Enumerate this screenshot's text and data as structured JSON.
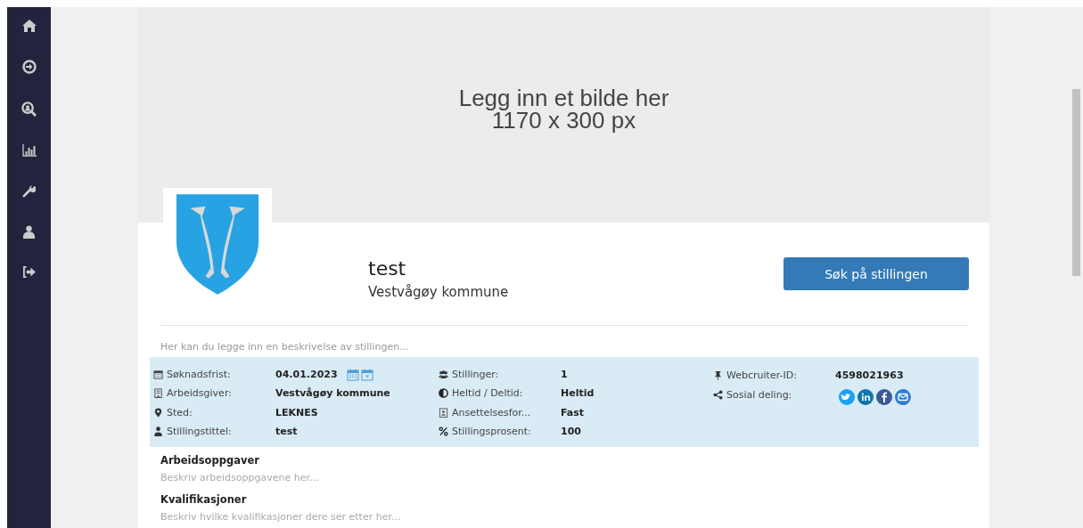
{
  "banner": {
    "lines": [
      "Legg inn et bilde her",
      "1170 x 300 px"
    ]
  },
  "job": {
    "title": "test",
    "employer": "Vestvågøy kommune"
  },
  "apply_button": "Søk på stillingen",
  "description": "Her kan du legge inn en beskrivelse av stillingen...",
  "facts": [
    [
      {
        "label": "Søknadsfrist:",
        "value": "04.01.2023"
      },
      {
        "label": "Arbeidsgiver:",
        "value": "Vestvågøy kommune"
      },
      {
        "label": "Sted:",
        "value": "LEKNES"
      },
      {
        "label": "Stillingstittel:",
        "value": "test"
      }
    ],
    [
      {
        "label": "Stillinger:",
        "value": "1"
      },
      {
        "label": "Heltid / Deltid:",
        "value": "Heltid"
      },
      {
        "label": "Ansettelsesfor...",
        "value": "Fast"
      },
      {
        "label": "Stillingsprosent:",
        "value": "100"
      }
    ],
    [
      {
        "label": "Webcruiter-ID:",
        "value": "4598021963"
      },
      {
        "label": "Sosial deling:",
        "kind": "social"
      }
    ]
  ],
  "sections": [
    {
      "heading": "Arbeidsoppgaver",
      "text": "Beskriv arbeidsoppgavene her..."
    },
    {
      "heading": "Kvalifikasjoner",
      "text": "Beskriv hvilke kvalifikasjoner dere ser etter her..."
    }
  ]
}
